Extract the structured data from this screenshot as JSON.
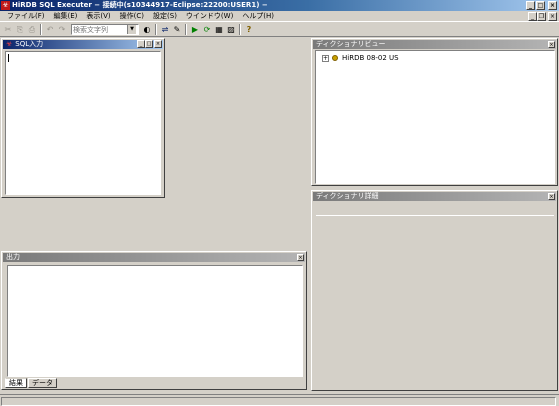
{
  "window": {
    "title": "HiRDB SQL Executer  − 接続中(s10344917-Eclipse:22200:USER1) −",
    "app_icon": "☣"
  },
  "title_buttons": {
    "minimize": "_",
    "maximize": "□",
    "close": "×"
  },
  "menu": {
    "items": [
      "ファイル(F)",
      "編集(E)",
      "表示(V)",
      "操作(C)",
      "設定(S)",
      "ウインドウ(W)",
      "ヘルプ(H)"
    ]
  },
  "mdi_buttons": {
    "minimize": "_",
    "restore": "❐",
    "close": "×"
  },
  "toolbar": {
    "icons": {
      "cut": "✂",
      "copy": "⎘",
      "paste": "⎙",
      "undo": "↶",
      "redo": "↷",
      "find": "◐",
      "link": "⇌",
      "edit": "✎",
      "run": "▶",
      "refresh": "⟳",
      "grid": "▦",
      "save": "▨",
      "help": "?"
    },
    "search_placeholder": "検索文字列",
    "dropdown_arrow": "▼"
  },
  "sql_panel": {
    "title": "SQL入力",
    "icon": "☣",
    "buttons": {
      "minimize": "_",
      "maximize": "□",
      "close": "×"
    }
  },
  "output_panel": {
    "title": "出力",
    "close": "×",
    "tabs": [
      "結果",
      "データ"
    ]
  },
  "dictionary_view": {
    "title": "ディクショナリビュー",
    "close": "×",
    "tree": [
      {
        "expander": "+",
        "label": "HiRDB 08-02   US"
      }
    ]
  },
  "dictionary_detail": {
    "title": "ディクショナリ詳細",
    "close": "×"
  },
  "colors": {
    "window_bg": "#d4d0c8",
    "titlebar_start": "#0a246a",
    "titlebar_end": "#a6caf0",
    "inactive_title": "#808080"
  }
}
